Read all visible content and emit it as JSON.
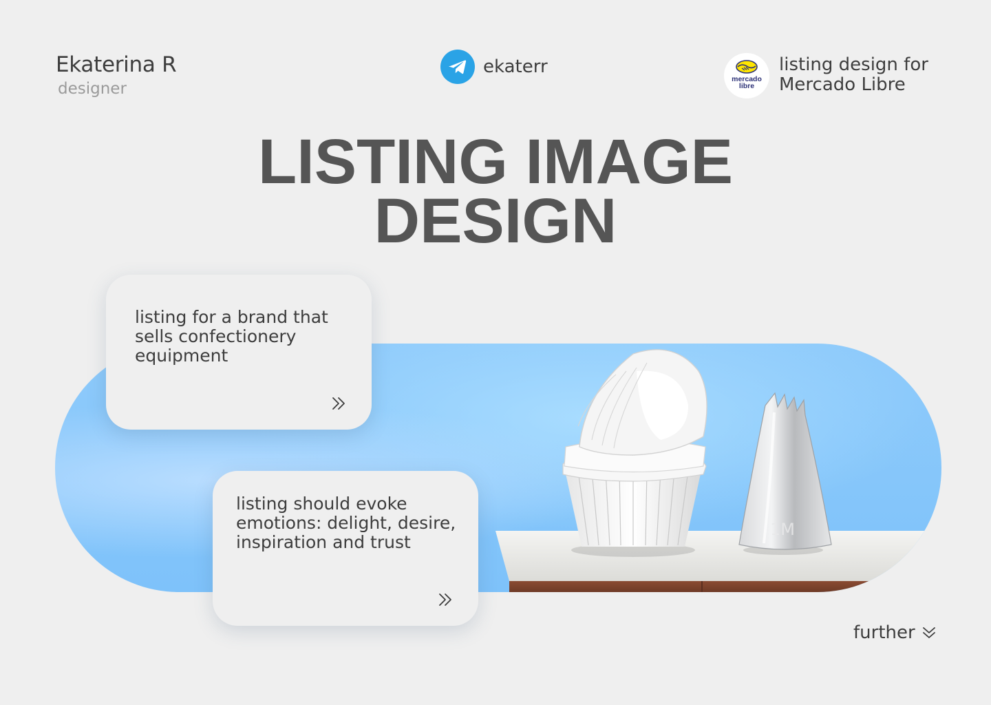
{
  "author": {
    "name": "Ekaterina R",
    "role": "designer"
  },
  "contact": {
    "icon": "telegram-icon",
    "handle": "ekaterr"
  },
  "client": {
    "logo_icon": "mercado-libre-logo",
    "logo_text_line1": "mercado",
    "logo_text_line2": "libre",
    "title_line1": "listing design for",
    "title_line2": "Mercado Libre"
  },
  "headline": {
    "line1": "LISTING IMAGE",
    "line2": "DESIGN"
  },
  "hero": {
    "product_label": "1M"
  },
  "cards": [
    {
      "text": "listing for a brand that sells confectionery equipment",
      "icon": "double-chevron-right-icon"
    },
    {
      "text": "listing should evoke emotions: delight, desire, inspiration and trust",
      "icon": "double-chevron-right-icon"
    }
  ],
  "footer": {
    "further_label": "further",
    "icon": "double-chevron-down-icon"
  },
  "colors": {
    "background": "#efefef",
    "text": "#3d3d3d",
    "muted": "#9a9a9a",
    "telegram": "#2aa3e6",
    "hero_blue": "#8fcbfb",
    "ml_yellow": "#ffe600",
    "ml_navy": "#2d3277"
  }
}
